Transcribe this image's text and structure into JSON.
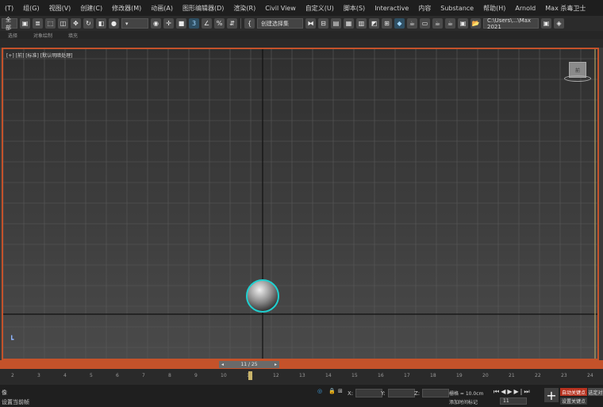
{
  "menu": [
    "(T)",
    "组(G)",
    "视图(V)",
    "创建(C)",
    "修改器(M)",
    "动画(A)",
    "图形编辑器(D)",
    "渲染(R)",
    "Civil View",
    "自定义(U)",
    "脚本(S)",
    "Interactive",
    "内容",
    "Substance",
    "帮助(H)",
    "Arnold",
    "Max 杀毒卫士"
  ],
  "toolbar": {
    "selection_filter": "全部",
    "named_selection": "创建选择集",
    "workspace_path": "C:\\Users\\...\\Max 2021"
  },
  "ribbon": [
    "选择",
    "对象绘制",
    "填充"
  ],
  "viewport": {
    "label": "[+] [前] [标准] [默认明暗处理]",
    "viewcube_label": "前"
  },
  "timeline": {
    "current": "11 / 25",
    "ticks": [
      "2",
      "3",
      "4",
      "5",
      "6",
      "7",
      "8",
      "9",
      "10",
      "11",
      "12",
      "13",
      "14",
      "15",
      "16",
      "17",
      "18",
      "19",
      "20",
      "21",
      "22",
      "23",
      "24"
    ]
  },
  "status": {
    "line1": "像",
    "line2": "设置当前帧",
    "x_label": "X:",
    "y_label": "Y:",
    "z_label": "Z:",
    "grid": "栅格 = 10.0cm",
    "add_time_tag": "添加时间标记",
    "frame_input": "11",
    "auto_key": "自动关键点",
    "set_key": "设置关键点",
    "selected": "选定对"
  },
  "colors": {
    "active_border": "#c4522a",
    "selection": "#1fd0d0",
    "auto_key_button": "#b8321f"
  }
}
